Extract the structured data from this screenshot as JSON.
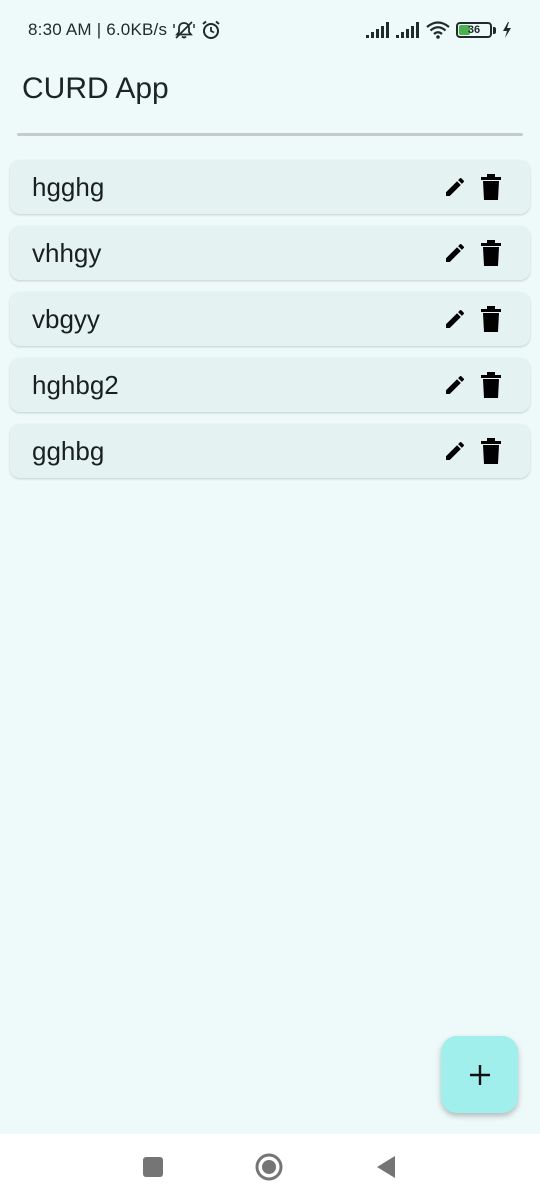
{
  "status_bar": {
    "time_and_speed": "8:30 AM | 6.0KB/s",
    "battery_level": "36",
    "icons": [
      "muted-notification-icon",
      "alarm-icon",
      "signal-icon",
      "signal-icon",
      "wifi-icon",
      "battery-icon",
      "charging-icon"
    ]
  },
  "app_bar": {
    "title": "CURD App"
  },
  "list": {
    "items": [
      {
        "label": "hgghg"
      },
      {
        "label": "vhhgy"
      },
      {
        "label": "vbgyy"
      },
      {
        "label": "hghbg2"
      },
      {
        "label": "gghbg"
      }
    ],
    "item_icons": [
      "edit-icon",
      "delete-icon"
    ]
  },
  "fab": {
    "icon": "add-icon"
  },
  "nav_bar": {
    "icons": [
      "recents-icon",
      "home-icon",
      "back-icon"
    ]
  },
  "colors": {
    "background": "#eefafa",
    "card": "#e4f3f2",
    "fab": "#a0efec",
    "divider": "#c3cbcb",
    "battery_fill": "#4caf50"
  }
}
